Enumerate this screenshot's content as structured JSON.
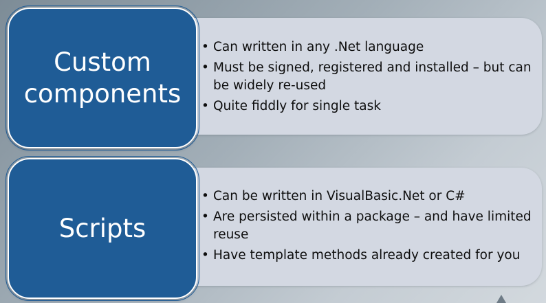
{
  "rows": [
    {
      "label_lines": [
        "Custom",
        "components"
      ],
      "bullets": [
        "Can written in any .Net language",
        "Must be signed, registered and installed – but can be widely re-used",
        "Quite fiddly for single task"
      ]
    },
    {
      "label_lines": [
        "Scripts"
      ],
      "bullets": [
        "Can be written in VisualBasic.Net or C#",
        "Are persisted within a package – and have limited reuse",
        "Have template methods already created for you"
      ]
    }
  ],
  "colors": {
    "label_box_fill": "#1f5c96",
    "panel_fill": "#d3d8e2",
    "label_text": "#ffffff",
    "bullet_text": "#0e0e0e"
  }
}
